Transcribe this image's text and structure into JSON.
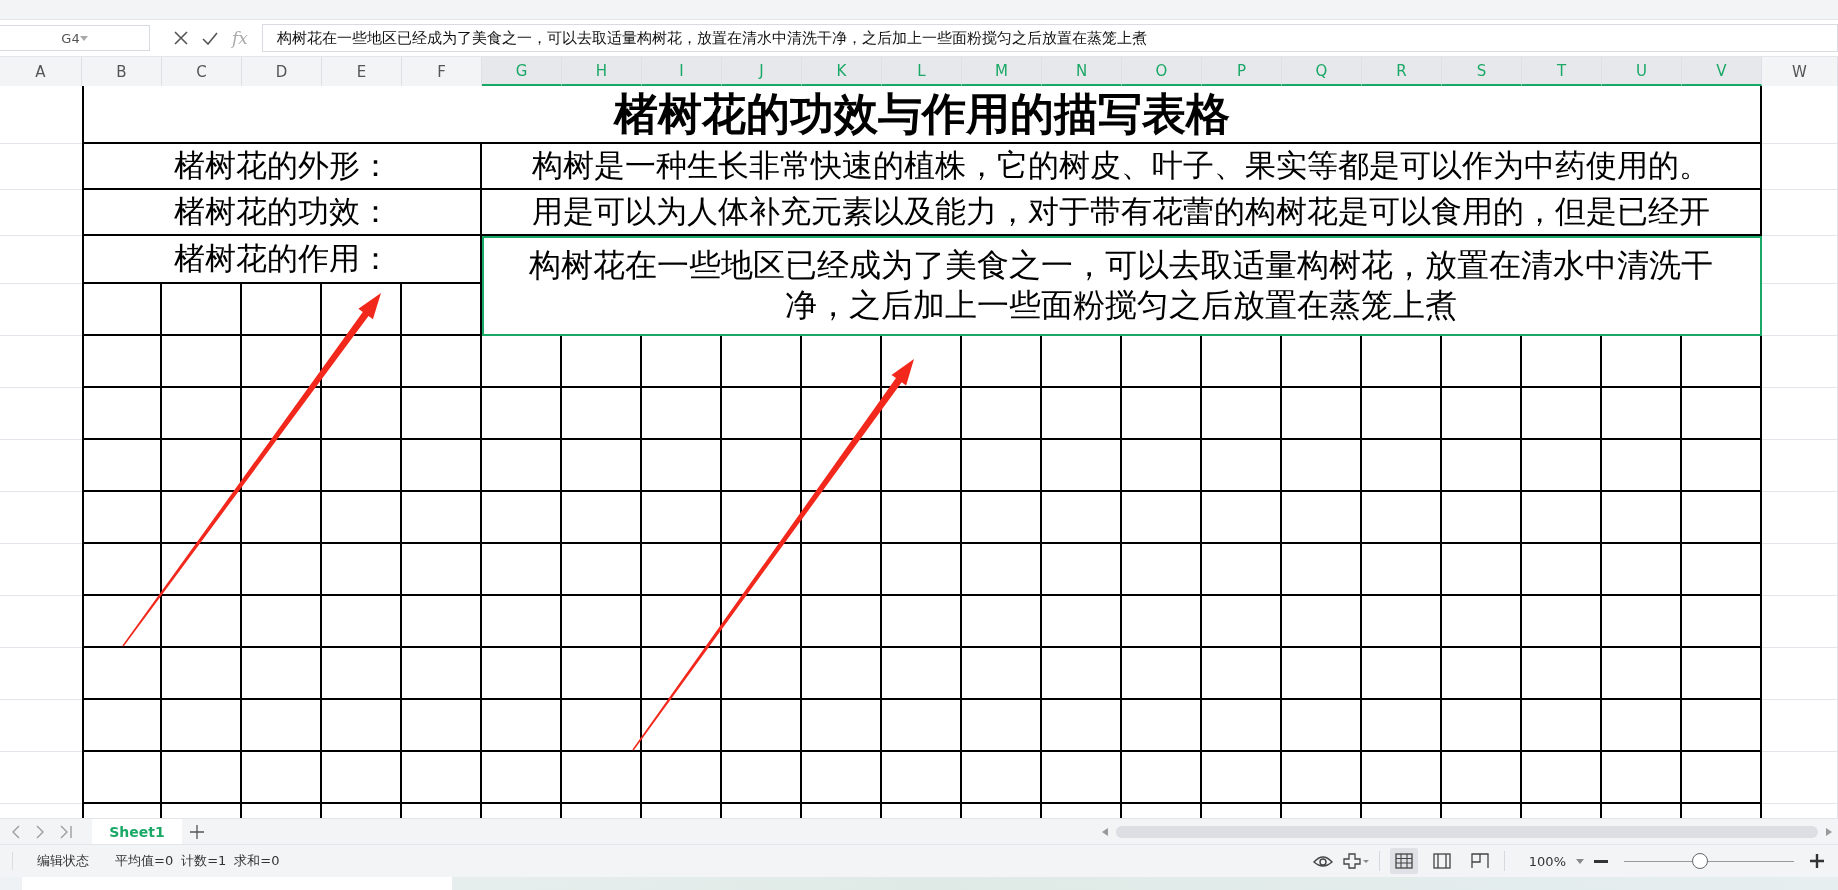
{
  "formula_bar": {
    "cell_ref": "G4",
    "function_label": "fx",
    "formula": "构树花在一些地区已经成为了美食之一，可以去取适量构树花，放置在清水中清洗干净，之后加上一些面粉搅匀之后放置在蒸笼上煮"
  },
  "columns": [
    {
      "label": "A",
      "selected": false
    },
    {
      "label": "B",
      "selected": false
    },
    {
      "label": "C",
      "selected": false
    },
    {
      "label": "D",
      "selected": false
    },
    {
      "label": "E",
      "selected": false
    },
    {
      "label": "F",
      "selected": false
    },
    {
      "label": "G",
      "selected": true
    },
    {
      "label": "H",
      "selected": true
    },
    {
      "label": "I",
      "selected": true
    },
    {
      "label": "J",
      "selected": true
    },
    {
      "label": "K",
      "selected": true
    },
    {
      "label": "L",
      "selected": true
    },
    {
      "label": "M",
      "selected": true
    },
    {
      "label": "N",
      "selected": true
    },
    {
      "label": "O",
      "selected": true
    },
    {
      "label": "P",
      "selected": true
    },
    {
      "label": "Q",
      "selected": true
    },
    {
      "label": "R",
      "selected": true
    },
    {
      "label": "S",
      "selected": true
    },
    {
      "label": "T",
      "selected": true
    },
    {
      "label": "U",
      "selected": true
    },
    {
      "label": "V",
      "selected": true
    },
    {
      "label": "W",
      "selected": false
    }
  ],
  "sheet": {
    "title": "楮树花的功效与作用的描写表格",
    "rows": [
      {
        "label": "楮树花的外形：",
        "text": "构树是一种生长非常快速的植株，它的树皮、叶子、果实等都是可以作为中药使用的。",
        "selected": false
      },
      {
        "label": "楮树花的功效：",
        "text": "用是可以为人体补充元素以及能力，对于带有花蕾的构树花是可以食用的，但是已经开",
        "selected": false
      },
      {
        "label": "楮树花的作用：",
        "text": "构树花在一些地区已经成为了美食之一，可以去取适量构树花，放置在清水中清洗干净，之后加上一些面粉搅匀之后放置在蒸笼上煮",
        "selected": true
      }
    ]
  },
  "sheet_tabs": [
    {
      "label": "Sheet1",
      "selected": true
    }
  ],
  "status_bar": {
    "mode": "编辑状态",
    "stats": [
      "平均值=0",
      "计数=1",
      "求和=0"
    ],
    "view_modes": [
      {
        "kind": "normal",
        "selected": true
      },
      {
        "kind": "page-break",
        "selected": false
      },
      {
        "kind": "page-layout",
        "selected": false
      }
    ],
    "zoom": "100%",
    "zoom_slider": {
      "level": 0.44
    }
  }
}
